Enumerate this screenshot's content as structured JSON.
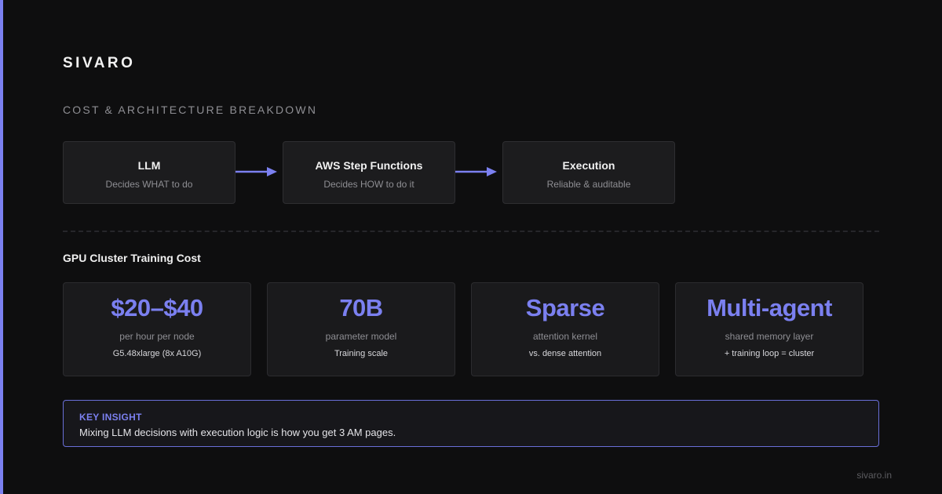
{
  "brand": "SIVARO",
  "section_title": "COST & ARCHITECTURE BREAKDOWN",
  "flow": [
    {
      "title": "LLM",
      "subtitle": "Decides WHAT to do"
    },
    {
      "title": "AWS Step Functions",
      "subtitle": "Decides HOW to do it"
    },
    {
      "title": "Execution",
      "subtitle": "Reliable & auditable"
    }
  ],
  "gpu_section": {
    "title": "GPU Cluster Training Cost",
    "cards": [
      {
        "value": "$20–$40",
        "label": "per hour per node",
        "detail": "G5.48xlarge (8x A10G)"
      },
      {
        "value": "70B",
        "label": "parameter model",
        "detail": "Training scale"
      },
      {
        "value": "Sparse",
        "label": "attention kernel",
        "detail": "vs. dense attention"
      },
      {
        "value": "Multi-agent",
        "label": "shared memory layer",
        "detail": "+ training loop = cluster"
      }
    ]
  },
  "insight": {
    "label": "KEY INSIGHT",
    "text": "Mixing LLM decisions with execution logic is how you get 3 AM pages."
  },
  "footer": {
    "url": "sivaro.in"
  },
  "colors": {
    "accent": "#7b80f0",
    "background": "#0e0e0f",
    "card": "#1c1c1e",
    "muted_text": "#8e8e93"
  }
}
